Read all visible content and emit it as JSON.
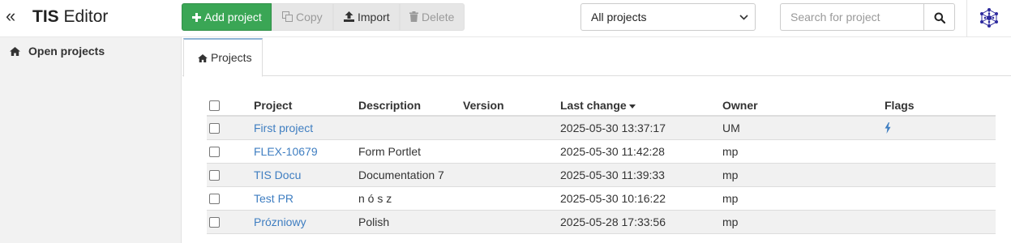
{
  "header": {
    "collapse_icon": "«",
    "brand_bold": "TIS",
    "brand_rest": " Editor"
  },
  "toolbar": {
    "add_label": "Add project",
    "copy_label": "Copy",
    "import_label": "Import",
    "delete_label": "Delete"
  },
  "filter": {
    "selected": "All projects"
  },
  "search": {
    "placeholder": "Search for project"
  },
  "sidebar": {
    "items": [
      {
        "label": "Open projects",
        "icon": "home-icon"
      }
    ]
  },
  "tabs": [
    {
      "label": "Projects",
      "icon": "home-icon",
      "active": true
    }
  ],
  "table": {
    "columns": [
      "Project",
      "Description",
      "Version",
      "Last change",
      "Owner",
      "Flags"
    ],
    "sorted_column": "Last change",
    "sort_direction": "desc",
    "rows": [
      {
        "project": "First project",
        "description": "",
        "version": "",
        "last_change": "2025-05-30 13:37:17",
        "owner": "UM",
        "flag": "bolt-icon"
      },
      {
        "project": "FLEX-10679",
        "description": "Form Portlet",
        "version": "",
        "last_change": "2025-05-30 11:42:28",
        "owner": "mp",
        "flag": ""
      },
      {
        "project": "TIS Docu",
        "description": "Documentation 7",
        "version": "",
        "last_change": "2025-05-30 11:39:33",
        "owner": "mp",
        "flag": ""
      },
      {
        "project": "Test PR",
        "description": "n ó s z",
        "version": "",
        "last_change": "2025-05-30 10:16:22",
        "owner": "mp",
        "flag": ""
      },
      {
        "project": "Prózniowy",
        "description": "Polish",
        "version": "",
        "last_change": "2025-05-28 17:33:56",
        "owner": "mp",
        "flag": ""
      }
    ]
  },
  "colors": {
    "accent_green": "#3aa655",
    "link_blue": "#3f7ec1",
    "tab_border": "#8fb4d6",
    "logo_purple": "#2d2a9e"
  }
}
